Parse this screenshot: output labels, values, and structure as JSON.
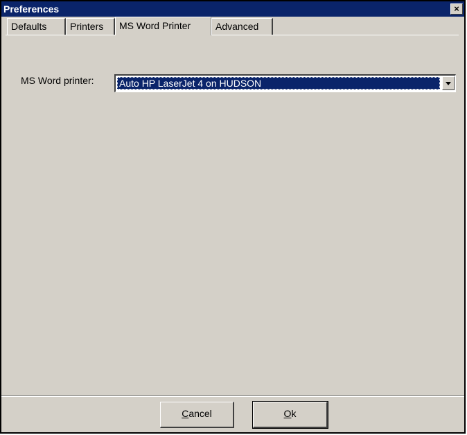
{
  "window": {
    "title": "Preferences",
    "close_glyph": "×"
  },
  "tabs": [
    {
      "label": "Defaults",
      "active": false
    },
    {
      "label": "Printers",
      "active": false
    },
    {
      "label": "MS Word Printer",
      "active": true
    },
    {
      "label": "Advanced",
      "active": false
    }
  ],
  "ms_word": {
    "label": "MS Word printer:",
    "selected_value": "Auto HP LaserJet 4 on HUDSON"
  },
  "buttons": {
    "cancel_mnemonic": "C",
    "cancel_rest": "ancel",
    "ok_mnemonic": "O",
    "ok_rest": "k"
  },
  "colors": {
    "face": "#d4d0c8",
    "titlebar": "#0a246a",
    "selection": "#0a246a"
  }
}
